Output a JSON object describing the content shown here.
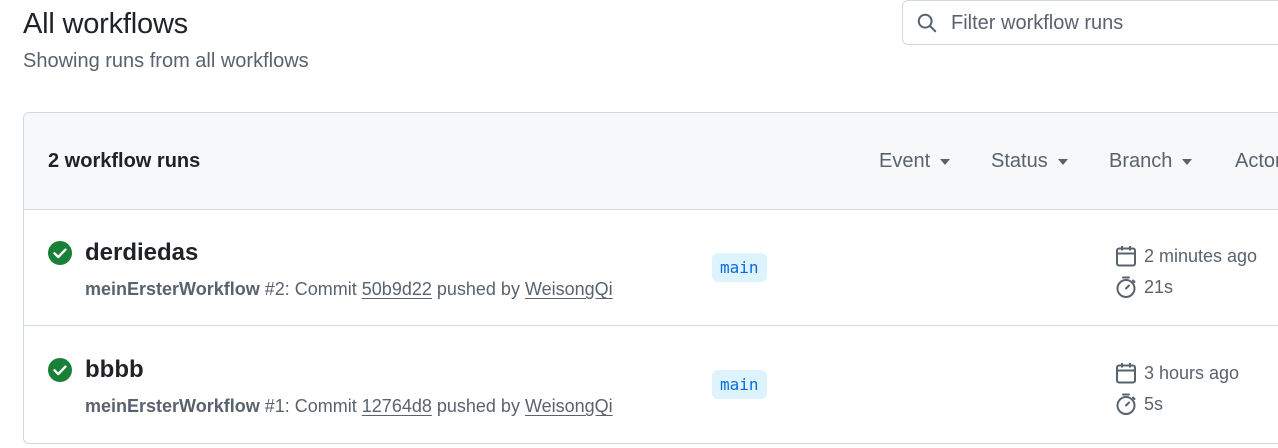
{
  "header": {
    "title": "All workflows",
    "subtitle": "Showing runs from all workflows"
  },
  "search": {
    "placeholder": "Filter workflow runs",
    "icon": "search-icon"
  },
  "list": {
    "count_label": "2 workflow runs",
    "filters": [
      "Event",
      "Status",
      "Branch",
      "Actor"
    ]
  },
  "runs": [
    {
      "title": "derdiedas",
      "workflow": "meinErsterWorkflow",
      "run_number": "#2",
      "event_text": ": Commit",
      "commit": "50b9d22",
      "pushed_text": "pushed by",
      "actor": "WeisongQi",
      "branch": "main",
      "time": "2 minutes ago",
      "duration": "21s",
      "status": "success"
    },
    {
      "title": "bbbb",
      "workflow": "meinErsterWorkflow",
      "run_number": "#1",
      "event_text": ": Commit",
      "commit": "12764d8",
      "pushed_text": "pushed by",
      "actor": "WeisongQi",
      "branch": "main",
      "time": "3 hours ago",
      "duration": "5s",
      "status": "success"
    }
  ],
  "colors": {
    "success": "#1a7f37",
    "branch_bg": "#ddf4ff",
    "branch_fg": "#0969da",
    "muted": "#59636e"
  }
}
